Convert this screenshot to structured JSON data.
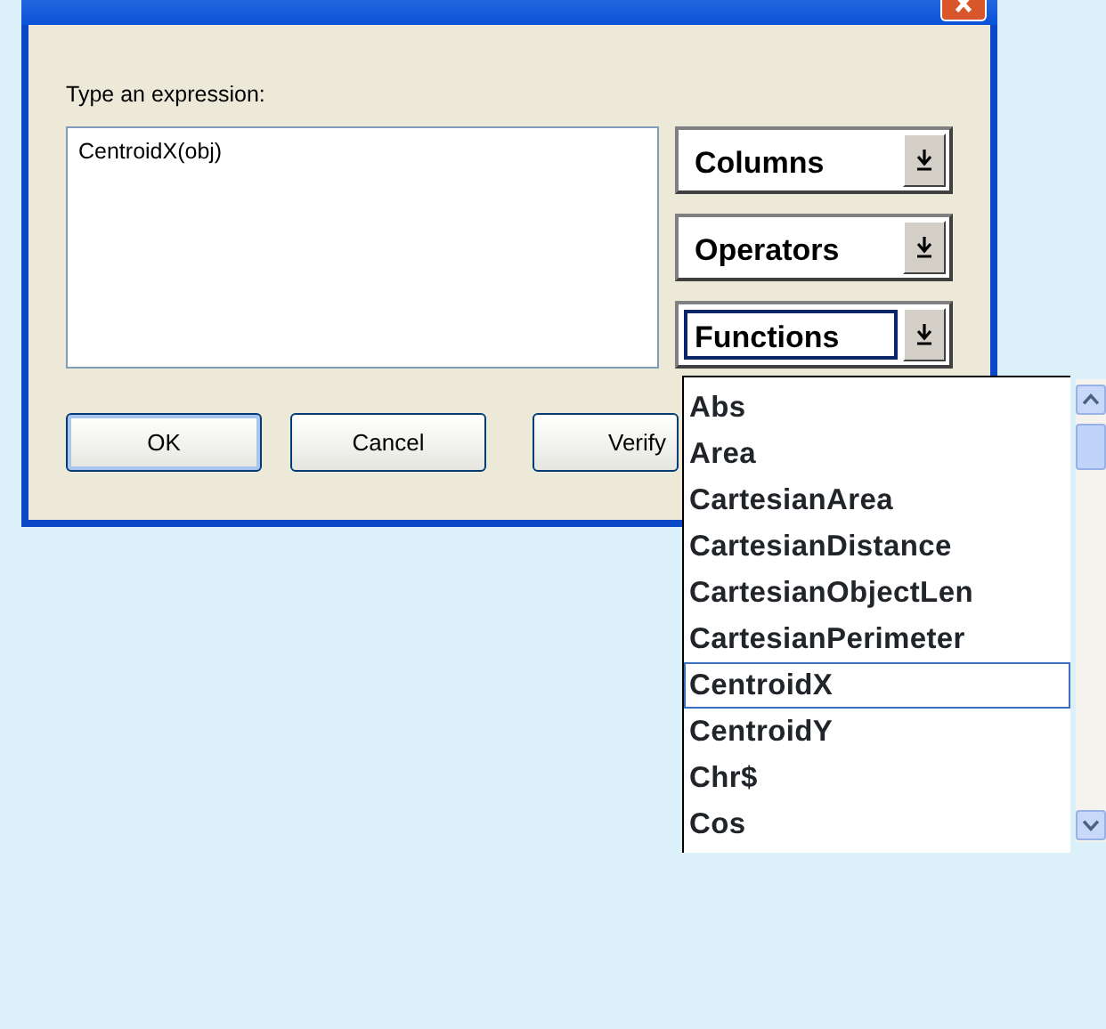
{
  "dialog": {
    "prompt": "Type an expression:",
    "expression": "CentroidX(obj)",
    "dropdowns": [
      {
        "label": "Columns",
        "focused": false
      },
      {
        "label": "Operators",
        "focused": false
      },
      {
        "label": "Functions",
        "focused": true
      }
    ],
    "buttons": [
      {
        "label": "OK",
        "default": true
      },
      {
        "label": "Cancel",
        "default": false
      },
      {
        "label": "Verify",
        "default": false
      }
    ]
  },
  "function_list": {
    "items": [
      {
        "label": "Abs",
        "selected": false
      },
      {
        "label": "Area",
        "selected": false
      },
      {
        "label": "CartesianArea",
        "selected": false
      },
      {
        "label": "CartesianDistance",
        "selected": false
      },
      {
        "label": "CartesianObjectLen",
        "selected": false
      },
      {
        "label": "CartesianPerimeter",
        "selected": false
      },
      {
        "label": "CentroidX",
        "selected": true
      },
      {
        "label": "CentroidY",
        "selected": false
      },
      {
        "label": "Chr$",
        "selected": false
      },
      {
        "label": "Cos",
        "selected": false
      }
    ]
  }
}
